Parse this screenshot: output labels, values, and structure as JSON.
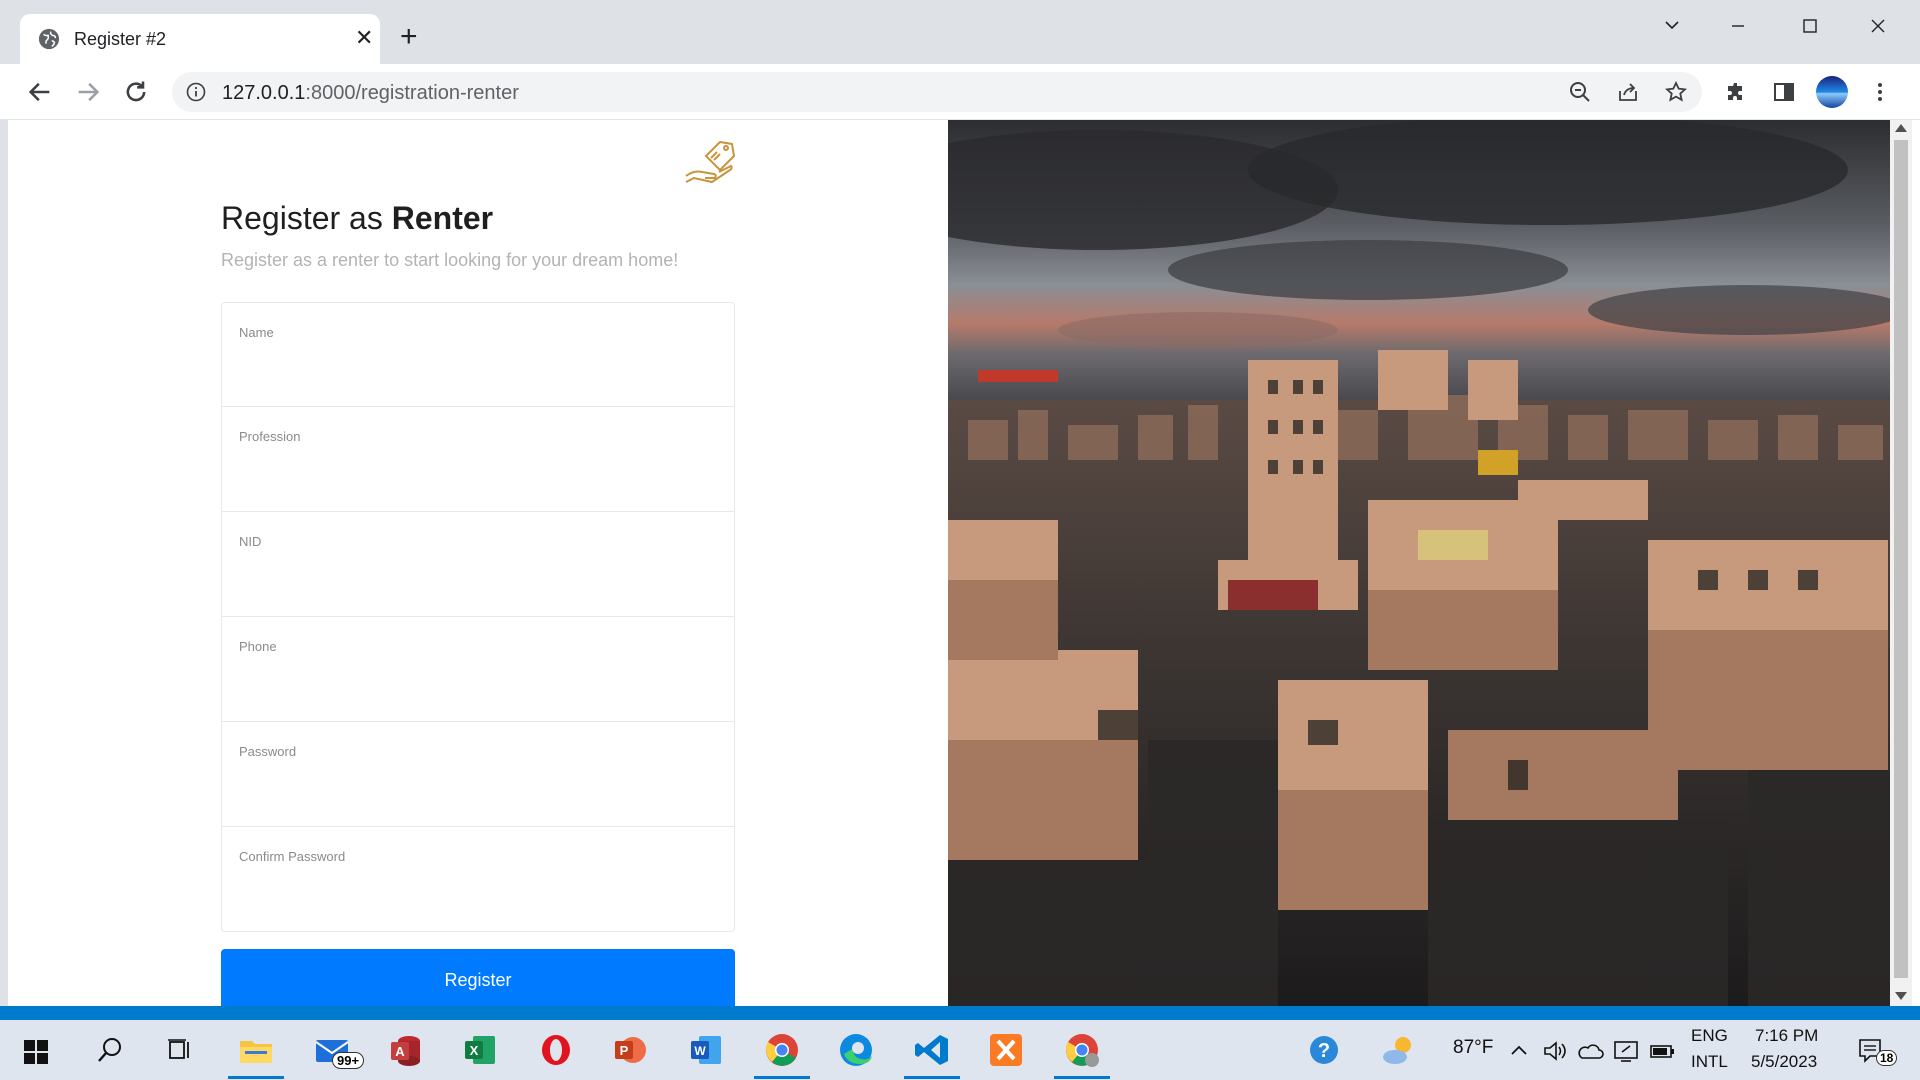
{
  "browser": {
    "tab_title": "Register #2",
    "tab_close": "✕",
    "new_tab": "+",
    "url_host": "127.0.0.1",
    "url_rest": ":8000/registration-renter"
  },
  "page": {
    "heading_prefix": "Register as ",
    "heading_bold": "Renter",
    "subheading": "Register as a renter to start looking for your dream home!",
    "fields": [
      {
        "label": "Name",
        "value": ""
      },
      {
        "label": "Profession",
        "value": ""
      },
      {
        "label": "NID",
        "value": ""
      },
      {
        "label": "Phone",
        "value": ""
      },
      {
        "label": "Password",
        "value": ""
      },
      {
        "label": "Confirm Password",
        "value": ""
      }
    ],
    "register_label": "Register",
    "accent_color": "#007bff"
  },
  "taskbar": {
    "mail_badge": "99+",
    "temperature": "87°F",
    "lang_line1": "ENG",
    "lang_line2": "INTL",
    "time": "7:16 PM",
    "date": "5/5/2023",
    "notification_count": "18"
  }
}
